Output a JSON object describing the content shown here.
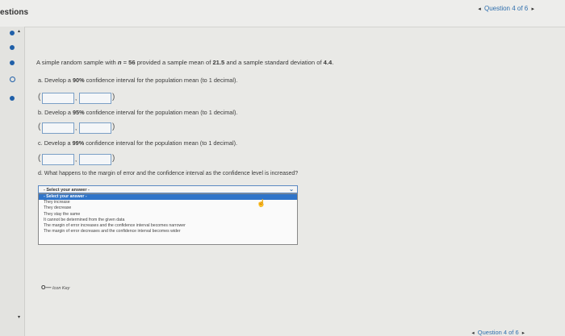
{
  "header": {
    "title": "estions",
    "nav_prev": "◂",
    "nav_label": "Question 4 of 6",
    "nav_next": "▸"
  },
  "sidebar": {
    "caret_up": "▴",
    "caret_down": "▾"
  },
  "problem": {
    "prefix": "A simple random sample with ",
    "n_label": "n",
    "equals": " = ",
    "n_value": "56",
    "middle": " provided a sample mean of ",
    "mean": "21.5",
    "middle2": " and a sample standard deviation of ",
    "sd": "4.4",
    "suffix": "."
  },
  "parts": {
    "a": {
      "prefix": "a. Develop a ",
      "pct": "90%",
      "suffix": " confidence interval for the population mean (to 1 decimal)."
    },
    "b": {
      "prefix": "b. Develop a ",
      "pct": "95%",
      "suffix": " confidence interval for the population mean (to 1 decimal)."
    },
    "c": {
      "prefix": "c. Develop a ",
      "pct": "99%",
      "suffix": " confidence interval for the population mean (to 1 decimal)."
    },
    "d": {
      "text": "d. What happens to the margin of error and the confidence interval as the confidence level is increased?"
    }
  },
  "interval": {
    "open": "(",
    "comma": ",",
    "close": ")"
  },
  "select": {
    "current": "- Select your answer -",
    "chevron": "⌄",
    "options": [
      "- Select your answer -",
      "They increase",
      "They decrease",
      "They stay the same",
      "It cannot be determined from the given data",
      "The margin of error increases and the confidence interval becomes narrower",
      "The margin of error decreases and the confidence interval becomes wider"
    ]
  },
  "icon_key": {
    "key": "O—",
    "label": " Icon Key"
  },
  "footer": {
    "nav_prev": "◂",
    "nav_label": "Question 4 of 6",
    "nav_next": "▸"
  }
}
